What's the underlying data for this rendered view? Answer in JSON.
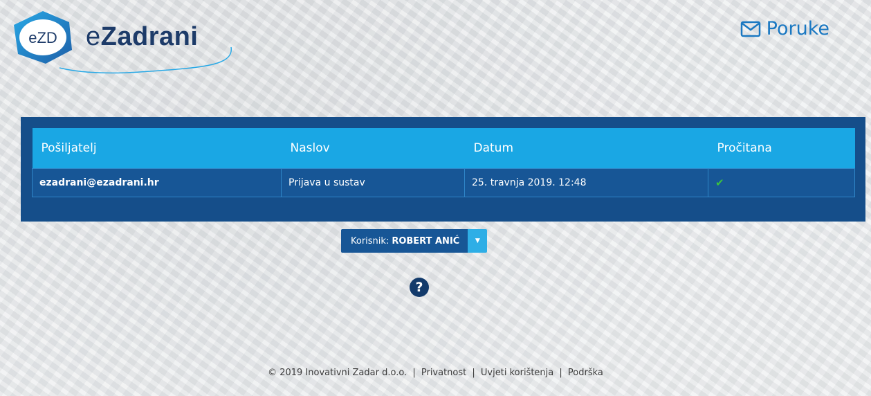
{
  "header": {
    "logo_badge": "eZD",
    "logo_prefix": "e",
    "logo_name": "Zadrani",
    "messages_label": "Poruke",
    "messages_icon": "envelope-icon"
  },
  "table": {
    "columns": [
      "Pošiljatelj",
      "Naslov",
      "Datum",
      "Pročitana"
    ],
    "rows": [
      {
        "sender": "ezadrani@ezadrani.hr",
        "subject": "Prijava u sustav",
        "date": "25. travnja 2019. 12:48",
        "read": "✔"
      }
    ]
  },
  "user": {
    "label": "Korisnik:",
    "name": "ROBERT ANIĆ"
  },
  "help_icon": "?",
  "footer": {
    "copyright": "© 2019 Inovativni Zadar d.o.o.",
    "privacy": "Privatnost",
    "terms": "Uvjeti korištenja",
    "support": "Podrška",
    "separator": "|"
  },
  "colors": {
    "panel": "#154e8a",
    "header_row": "#1aa7e4",
    "accent": "#1a78c2",
    "check": "#3cc43c"
  }
}
